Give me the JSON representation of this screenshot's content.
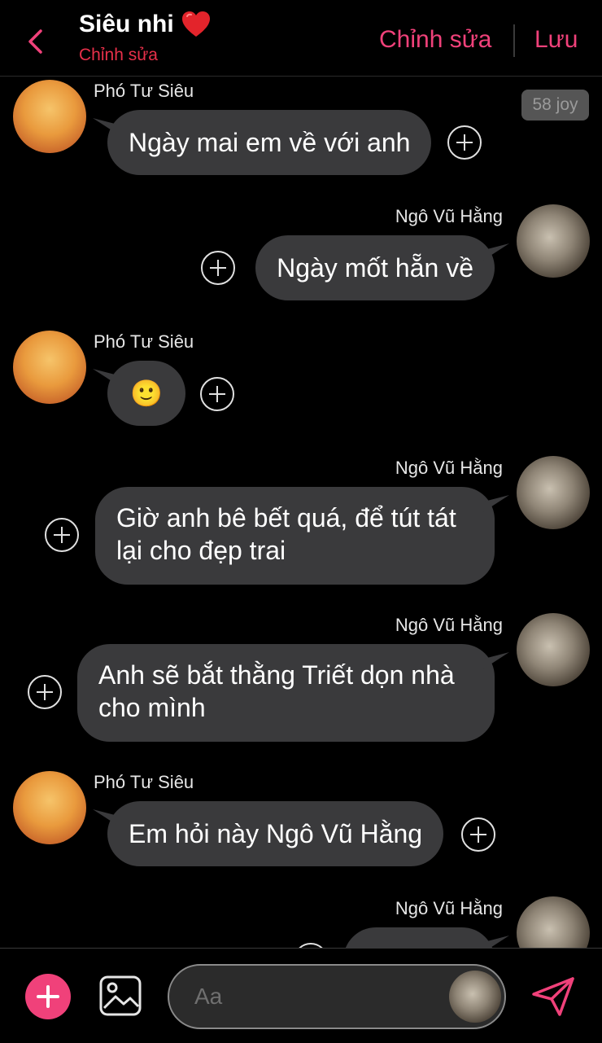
{
  "header": {
    "title": "Siêu nhi",
    "subtitle": "Chỉnh sửa",
    "edit_label": "Chỉnh sửa",
    "save_label": "Lưu",
    "accent": "#f0417a"
  },
  "badge": "58 joy",
  "messages": [
    {
      "sender": "Phó Tư Siêu",
      "text": "Ngày mai em về với anh"
    },
    {
      "sender": "Ngô Vũ Hằng",
      "text": "Ngày mốt hẵn về"
    },
    {
      "sender": "Phó Tư Siêu",
      "text": "🙂"
    },
    {
      "sender": "Ngô Vũ Hằng",
      "text": "Giờ anh bê bết quá, để tút tát lại cho đẹp trai"
    },
    {
      "sender": "Ngô Vũ Hằng",
      "text": "Anh sẽ bắt thằng Triết dọn nhà cho mình"
    },
    {
      "sender": "Phó Tư Siêu",
      "text": "Em hỏi này Ngô Vũ Hằng"
    },
    {
      "sender": "Ngô Vũ Hằng",
      "text": ""
    }
  ],
  "composer": {
    "placeholder": "Aa"
  }
}
